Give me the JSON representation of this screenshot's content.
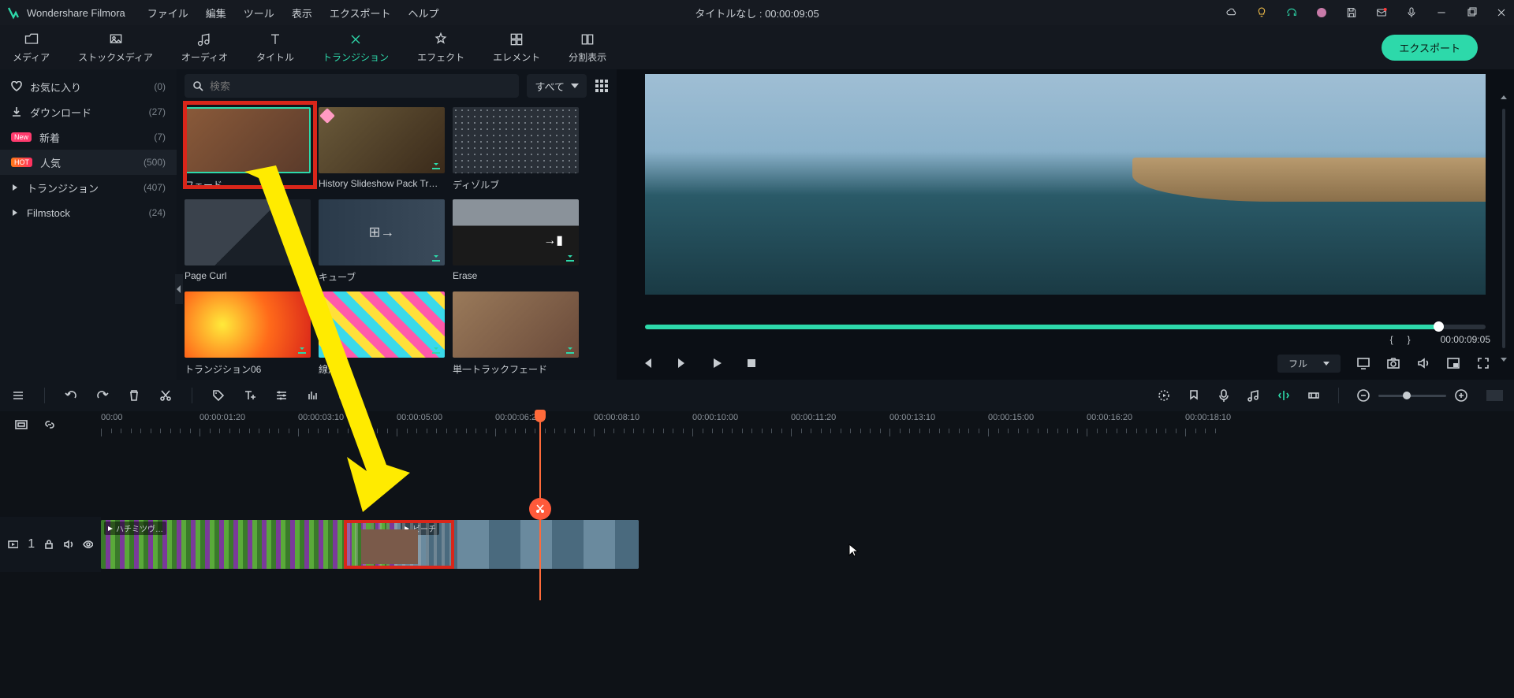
{
  "titlebar": {
    "app": "Wondershare Filmora",
    "menus": [
      "ファイル",
      "編集",
      "ツール",
      "表示",
      "エクスポート",
      "ヘルプ"
    ],
    "project": "タイトルなし : 00:00:09:05"
  },
  "toolbar": {
    "tabs": [
      {
        "label": "メディア"
      },
      {
        "label": "ストックメディア"
      },
      {
        "label": "オーディオ"
      },
      {
        "label": "タイトル"
      },
      {
        "label": "トランジション",
        "active": true
      },
      {
        "label": "エフェクト"
      },
      {
        "label": "エレメント"
      },
      {
        "label": "分割表示"
      }
    ],
    "export": "エクスポート"
  },
  "sidebar": {
    "items": [
      {
        "icon": "heart",
        "label": "お気に入り",
        "count": "(0)"
      },
      {
        "icon": "download",
        "label": "ダウンロード",
        "count": "(27)"
      },
      {
        "badge": "New",
        "label": "新着",
        "count": "(7)"
      },
      {
        "badge": "HOT",
        "label": "人気",
        "count": "(500)",
        "selected": true
      },
      {
        "icon": "caret",
        "label": "トランジション",
        "count": "(407)"
      },
      {
        "icon": "caret",
        "label": "Filmstock",
        "count": "(24)"
      }
    ]
  },
  "search": {
    "placeholder": "検索",
    "filter": "すべて"
  },
  "thumbs": [
    {
      "label": "フェード",
      "selected": true,
      "highlighted": true,
      "style": "photo"
    },
    {
      "label": "History Slideshow Pack Tr…",
      "diamond": true,
      "dl": true,
      "style": "collage"
    },
    {
      "label": "ディゾルブ",
      "style": "dots"
    },
    {
      "label": "Page Curl",
      "style": "corner"
    },
    {
      "label": "キューブ",
      "dl": true,
      "style": "cube"
    },
    {
      "label": "Erase",
      "dl": true,
      "style": "city"
    },
    {
      "label": "トランジション06",
      "dl": true,
      "style": "fire"
    },
    {
      "label": "線形 2",
      "dl": true,
      "style": "stripes"
    },
    {
      "label": "単一トラックフェード",
      "dl": true,
      "style": "photo2"
    }
  ],
  "preview": {
    "timecode": "00:00:09:05",
    "quality": "フル"
  },
  "timeline": {
    "marks": [
      "00:00",
      "00:00:01:20",
      "00:00:03:10",
      "00:00:05:00",
      "00:00:06:20",
      "00:00:08:10",
      "00:00:10:00",
      "00:00:11:20",
      "00:00:13:10",
      "00:00:15:00",
      "00:00:16:20",
      "00:00:18:10"
    ],
    "clip1_label": "ハチミツヴ…",
    "clip2_label": "ビーチ",
    "track_num": "1"
  }
}
